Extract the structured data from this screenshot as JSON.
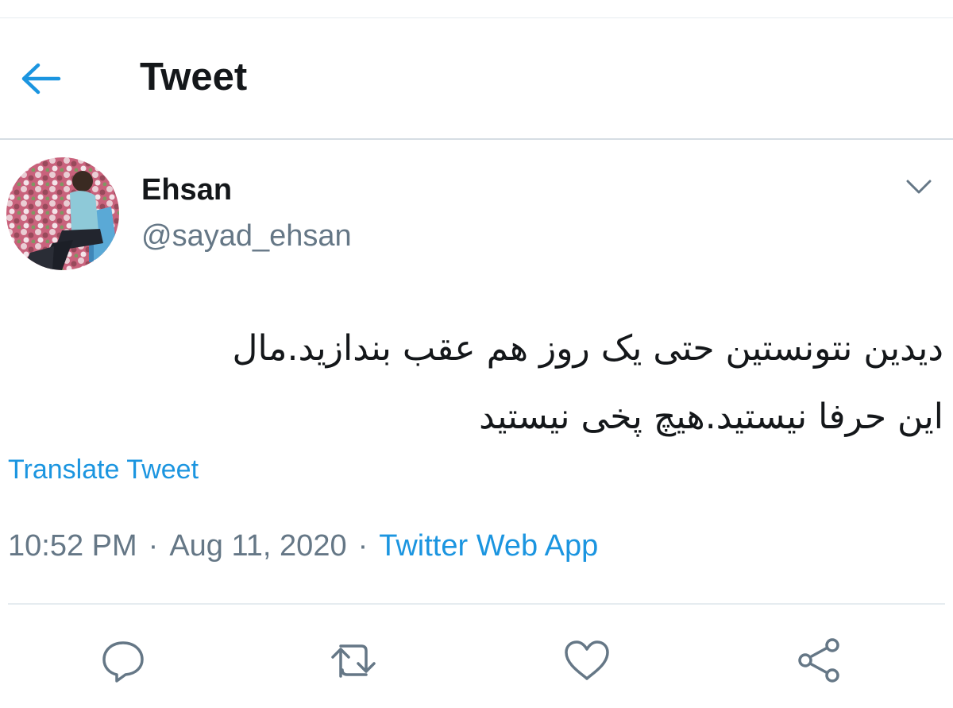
{
  "header": {
    "title": "Tweet",
    "back_icon": "arrow-left-icon"
  },
  "author": {
    "display_name": "Ehsan",
    "handle": "@sayad_ehsan",
    "avatar": "avatar-photo"
  },
  "tweet": {
    "text_lines": [
      "دیدین نتونستین حتی یک روز هم عقب بندازید.مال",
      "این حرفا نیستید.هیچ پخی نیستید"
    ],
    "translate_label": "Translate Tweet",
    "time": "10:52 PM",
    "date": "Aug 11, 2020",
    "separator": "·",
    "source": "Twitter Web App"
  },
  "actions": [
    {
      "icon": "reply-icon"
    },
    {
      "icon": "retweet-icon"
    },
    {
      "icon": "like-icon"
    },
    {
      "icon": "share-icon"
    }
  ],
  "colors": {
    "accent": "#1b95e0",
    "text": "#14171a",
    "secondary": "#657786",
    "divider": "#e6ecf0"
  }
}
